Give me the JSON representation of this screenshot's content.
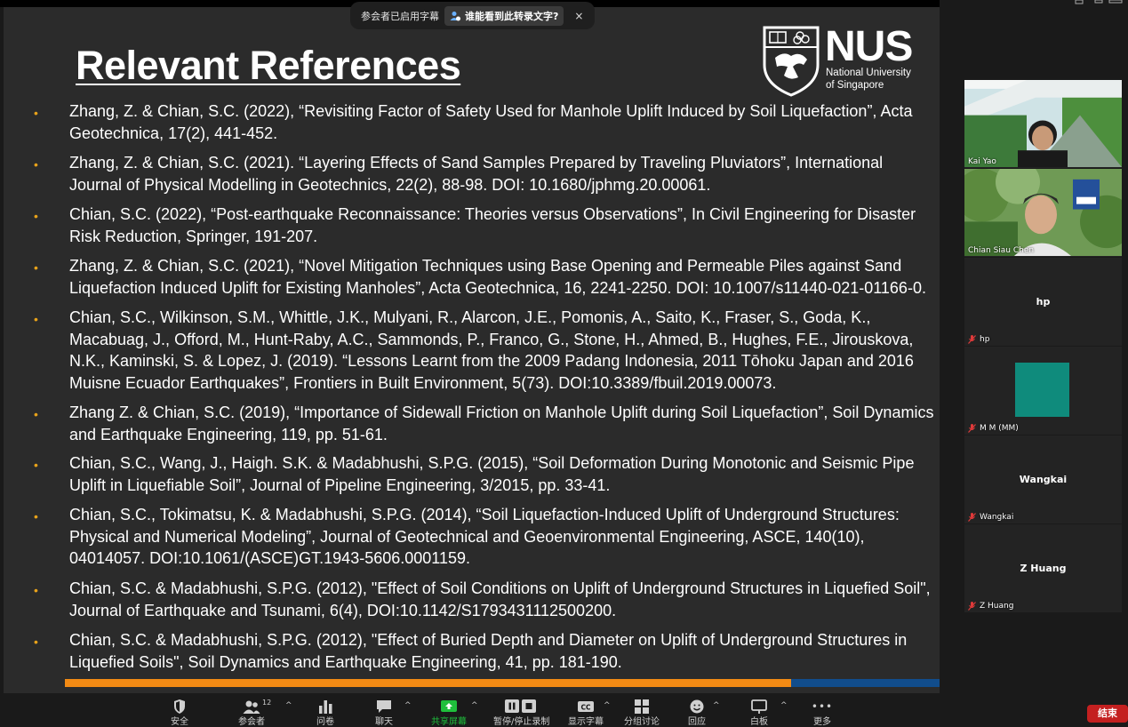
{
  "slide": {
    "title": "Relevant References",
    "logo": {
      "letters": "NUS",
      "subtitle_line1": "National University",
      "subtitle_line2": "of Singapore"
    },
    "references": [
      {
        "line1": "Zhang, Z. & Chian, S.C. (2022), “Revisiting Factor of Safety Used for Manhole Uplift Induced by Soil Liquefaction”, Acta",
        "line2": "Geotechnica, 17(2), 441-452."
      },
      {
        "line1": "Zhang, Z. & Chian, S.C. (2021). “Layering Effects of Sand Samples Prepared by Traveling Pluviators”, International",
        "line2": "Journal of Physical Modelling in Geotechnics, 22(2), 88-98. DOI: 10.1680/jphmg.20.00061."
      },
      {
        "line1": "Chian, S.C. (2022), “Post-earthquake Reconnaissance: Theories versus Observations”, In Civil Engineering for Disaster",
        "line2": "Risk Reduction, Springer, 191-207."
      },
      {
        "line1": "Zhang, Z. & Chian, S.C. (2021), “Novel Mitigation Techniques using Base Opening and Permeable Piles against Sand",
        "line2": "Liquefaction Induced Uplift for Existing Manholes”, Acta Geotechnica, 16, 2241-2250. DOI: 10.1007/s11440-021-01166-0."
      },
      {
        "line1": "Chian, S.C., Wilkinson, S.M., Whittle, J.K., Mulyani, R., Alarcon, J.E., Pomonis, A., Saito, K., Fraser, S., Goda, K.,",
        "line2": "Macabuag, J., Offord, M., Hunt-Raby, A.C., Sammonds, P., Franco, G., Stone, H., Ahmed, B., Hughes, F.E., Jirouskova,",
        "line3": "N.K., Kaminski, S. &  Lopez, J. (2019). “Lessons Learnt from the 2009 Padang Indonesia, 2011 Tōhoku Japan and 2016",
        "line4": "Muisne Ecuador Earthquakes”, Frontiers in Built Environment, 5(73). DOI:10.3389/fbuil.2019.00073."
      },
      {
        "line1": "Zhang Z. & Chian, S.C. (2019), “Importance of Sidewall Friction on Manhole Uplift during Soil Liquefaction”, Soil Dynamics",
        "line2": "and Earthquake Engineering, 119, pp. 51-61."
      },
      {
        "line1": "Chian, S.C., Wang, J., Haigh. S.K. & Madabhushi, S.P.G. (2015), “Soil Deformation During Monotonic and Seismic Pipe",
        "line2": "Uplift in Liquefiable Soil”, Journal of Pipeline Engineering, 3/2015, pp. 33-41."
      },
      {
        "line1": "Chian, S.C., Tokimatsu, K. & Madabhushi, S.P.G. (2014), “Soil Liquefaction-Induced Uplift of Underground Structures:",
        "line2": "Physical and Numerical Modeling”, Journal of Geotechnical and Geoenvironmental Engineering, ASCE, 140(10),",
        "line3": "04014057. DOI:10.1061/(ASCE)GT.1943-5606.0001159."
      },
      {
        "line1": "Chian, S.C. & Madabhushi, S.P.G. (2012), \"Effect of Soil Conditions on Uplift of Underground Structures in Liquefied Soil\",",
        "line2": "Journal of Earthquake and Tsunami, 6(4), DOI:10.1142/S1793431112500200."
      },
      {
        "line1": "Chian, S.C. & Madabhushi, S.P.G. (2012), \"Effect of Buried Depth and Diameter on Uplift of Underground Structures in",
        "line2": "Liquefied Soils\", Soil Dynamics and Earthquake Engineering, 41, pp. 181-190."
      }
    ],
    "progress_fraction": 0.83
  },
  "caption_bar": {
    "text": "参会者已启用字幕",
    "button_label": "谁能看到此转录文字?",
    "close_glyph": "×"
  },
  "participants": [
    {
      "name": "Kai Yao",
      "video": true,
      "muted": false
    },
    {
      "name": "Chian Siau Chen",
      "video": true,
      "muted": false
    },
    {
      "name": "hp",
      "display": "hp",
      "video": false,
      "muted": true
    },
    {
      "name": "M M (MM)",
      "video": false,
      "muted": true,
      "avatar_color": "#0f8b7c"
    },
    {
      "name": "Wangkai",
      "display": "Wangkai",
      "video": false,
      "muted": true
    },
    {
      "name": "Z Huang",
      "display": "Z Huang",
      "video": false,
      "muted": true
    }
  ],
  "toolbar": {
    "security": "安全",
    "participants": "参会者",
    "participants_count": "12",
    "polls": "问卷",
    "chat": "聊天",
    "share": "共享屏幕",
    "record": "暂停/停止录制",
    "captions": "显示字幕",
    "captions_badge": "CC",
    "breakout": "分组讨论",
    "reactions": "回应",
    "whiteboard": "白板",
    "more": "更多",
    "more_glyph": "•••",
    "caret": "^",
    "end": "结束"
  },
  "colors": {
    "accent_orange": "#f28a14",
    "accent_blue": "#114d8c",
    "bullet": "#e8a21a",
    "end_red": "#c42020",
    "share_green": "#1fbf3c"
  }
}
